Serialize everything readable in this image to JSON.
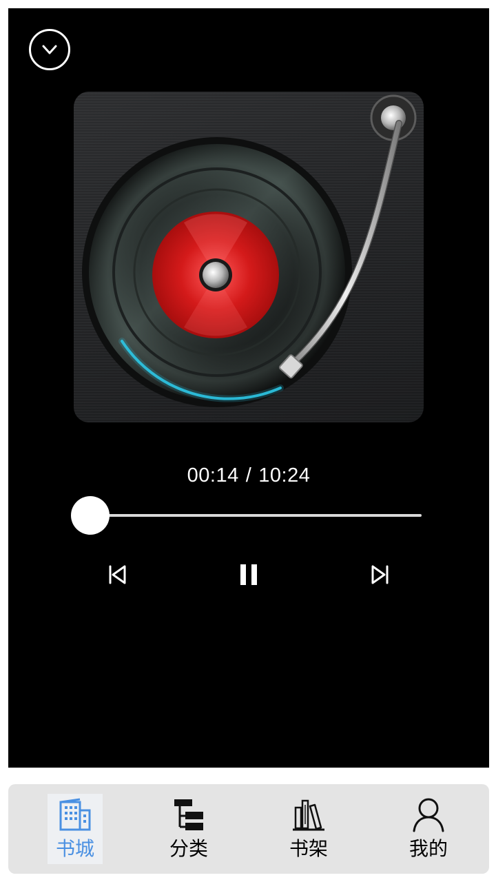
{
  "player": {
    "current_time": "00:14",
    "separator": "/",
    "total_time": "10:24",
    "progress_fraction": 0.022
  },
  "icons": {
    "collapse": "chevron-down-icon",
    "previous": "skip-previous-icon",
    "pause": "pause-icon",
    "next": "skip-next-icon"
  },
  "colors": {
    "background": "#000000",
    "nav_background": "#e4e4e4",
    "nav_active": "#4a90e2",
    "record_label": "#d42020",
    "progress_glow": "#2ec6e6"
  },
  "nav": {
    "active_index": 0,
    "items": [
      {
        "label": "书城",
        "icon": "bookstore-building-icon"
      },
      {
        "label": "分类",
        "icon": "category-tree-icon"
      },
      {
        "label": "书架",
        "icon": "bookshelf-icon"
      },
      {
        "label": "我的",
        "icon": "user-profile-icon"
      }
    ]
  }
}
